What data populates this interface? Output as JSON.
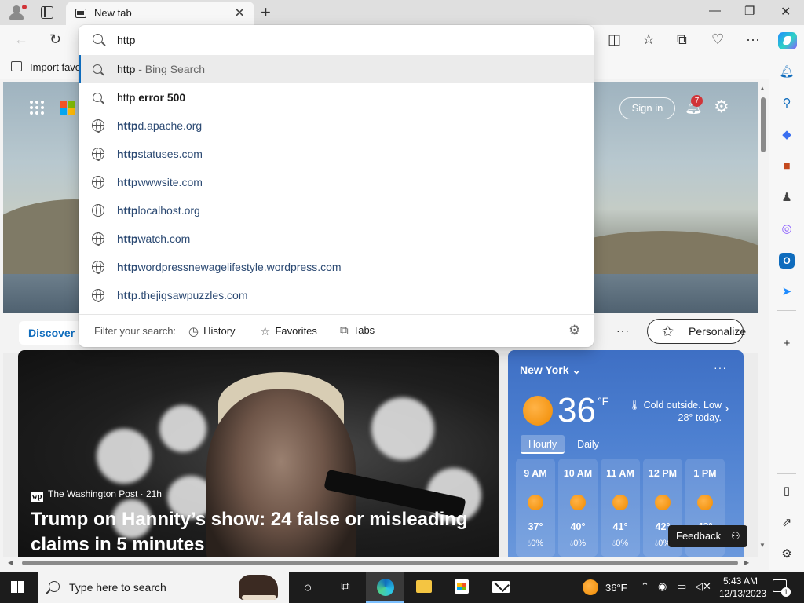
{
  "browser": {
    "tab": {
      "title": "New tab"
    },
    "favorites_bar": {
      "import_label": "Import favo"
    }
  },
  "address_dropdown": {
    "query": "http",
    "suggestions": [
      {
        "type": "search",
        "parts": [
          {
            "text": "http",
            "style": "plain"
          },
          {
            "text": " - Bing Search",
            "style": "dim"
          }
        ]
      },
      {
        "type": "search",
        "parts": [
          {
            "text": "http ",
            "style": "plain"
          },
          {
            "text": "error 500",
            "style": "bold"
          }
        ]
      },
      {
        "type": "site",
        "parts": [
          {
            "text": "http",
            "style": "url-bold"
          },
          {
            "text": "d.apache.org",
            "style": "url"
          }
        ]
      },
      {
        "type": "site",
        "parts": [
          {
            "text": "http",
            "style": "url-bold"
          },
          {
            "text": "statuses.com",
            "style": "url"
          }
        ]
      },
      {
        "type": "site",
        "parts": [
          {
            "text": "http",
            "style": "url-bold"
          },
          {
            "text": "wwwsite.com",
            "style": "url"
          }
        ]
      },
      {
        "type": "site",
        "parts": [
          {
            "text": "http",
            "style": "url-bold"
          },
          {
            "text": "localhost.org",
            "style": "url"
          }
        ]
      },
      {
        "type": "site",
        "parts": [
          {
            "text": "http",
            "style": "url-bold"
          },
          {
            "text": "watch.com",
            "style": "url"
          }
        ]
      },
      {
        "type": "site",
        "parts": [
          {
            "text": "http",
            "style": "url-bold"
          },
          {
            "text": "wordpressnewagelifestyle.wordpress.com",
            "style": "url"
          }
        ]
      },
      {
        "type": "site",
        "parts": [
          {
            "text": "http",
            "style": "url-bold"
          },
          {
            "text": ".thejigsawpuzzles.com",
            "style": "url"
          }
        ]
      }
    ],
    "footer": {
      "filter_label": "Filter your search:",
      "history_label": "History",
      "favorites_label": "Favorites",
      "tabs_label": "Tabs"
    }
  },
  "ntp": {
    "sign_in_label": "Sign in",
    "notification_count": "7",
    "feed": {
      "discover_label": "Discover",
      "more_label": "···",
      "personalize_label": "Personalize"
    },
    "news": {
      "source": "The Washington Post · 21h",
      "source_logo": "wp",
      "title": "Trump on Hannity’s show: 24 false or misleading claims in 5 minutes"
    },
    "weather": {
      "city": "New York",
      "temp": "36",
      "unit": "°F",
      "description": "Cold outside. Low 28° today.",
      "tabs": [
        "Hourly",
        "Daily"
      ],
      "hours": [
        {
          "time": "9 AM",
          "temp": "37°",
          "precip": "0%"
        },
        {
          "time": "10 AM",
          "temp": "40°",
          "precip": "0%"
        },
        {
          "time": "11 AM",
          "temp": "41°",
          "precip": "0%"
        },
        {
          "time": "12 PM",
          "temp": "42°",
          "precip": "0%"
        },
        {
          "time": "1 PM",
          "temp": "43°",
          "precip": "0%"
        }
      ]
    },
    "feedback_label": "Feedback"
  },
  "taskbar": {
    "search_placeholder": "Type here to search",
    "weather_temp": "36°F",
    "time": "5:43 AM",
    "date": "12/13/2023",
    "notification_count": "1"
  },
  "colors": {
    "accent": "#0f6cbd",
    "url_text": "#2c4a73",
    "badge_red": "#d13438",
    "taskbar_bg": "#1c1c1c"
  }
}
